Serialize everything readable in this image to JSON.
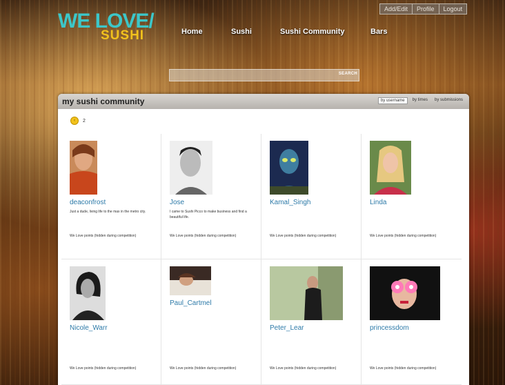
{
  "logo": {
    "line1": "WE LOVE/",
    "line2": "SUSHI"
  },
  "user_links": [
    "Add/Edit",
    "Profile",
    "Logout"
  ],
  "nav": [
    "Home",
    "Sushi",
    "Sushi Community",
    "Bars"
  ],
  "search": {
    "button_label": "SEARCH",
    "placeholder": ""
  },
  "panel": {
    "title": "my sushi community",
    "sort_tabs": [
      "by username",
      "by times",
      "by submissions"
    ],
    "active_sort": "by username",
    "page_number": "2"
  },
  "members": [
    {
      "name": "deaconfrost",
      "bio": "Just a dude, living life to the max in the metro city.",
      "points": "We Love points (hidden during competition)"
    },
    {
      "name": "Jose",
      "bio": "I came to Sushi Picco to make business and find a beautiful life.",
      "points": "We Love points (hidden during competition)"
    },
    {
      "name": "Kamal_Singh",
      "bio": "",
      "points": "We Love points (hidden during competition)"
    },
    {
      "name": "Linda",
      "bio": "",
      "points": "We Love points (hidden during competition)"
    },
    {
      "name": "Nicole_Warr",
      "bio": "",
      "points": "We Love points (hidden during competition)"
    },
    {
      "name": "Paul_Cartmel",
      "bio": "",
      "points": "We Love points (hidden during competition)"
    },
    {
      "name": "Peter_Lear",
      "bio": "",
      "points": "We Love points (hidden during competition)"
    },
    {
      "name": "princessdom",
      "bio": "",
      "points": "We Love points (hidden during competition)"
    }
  ]
}
